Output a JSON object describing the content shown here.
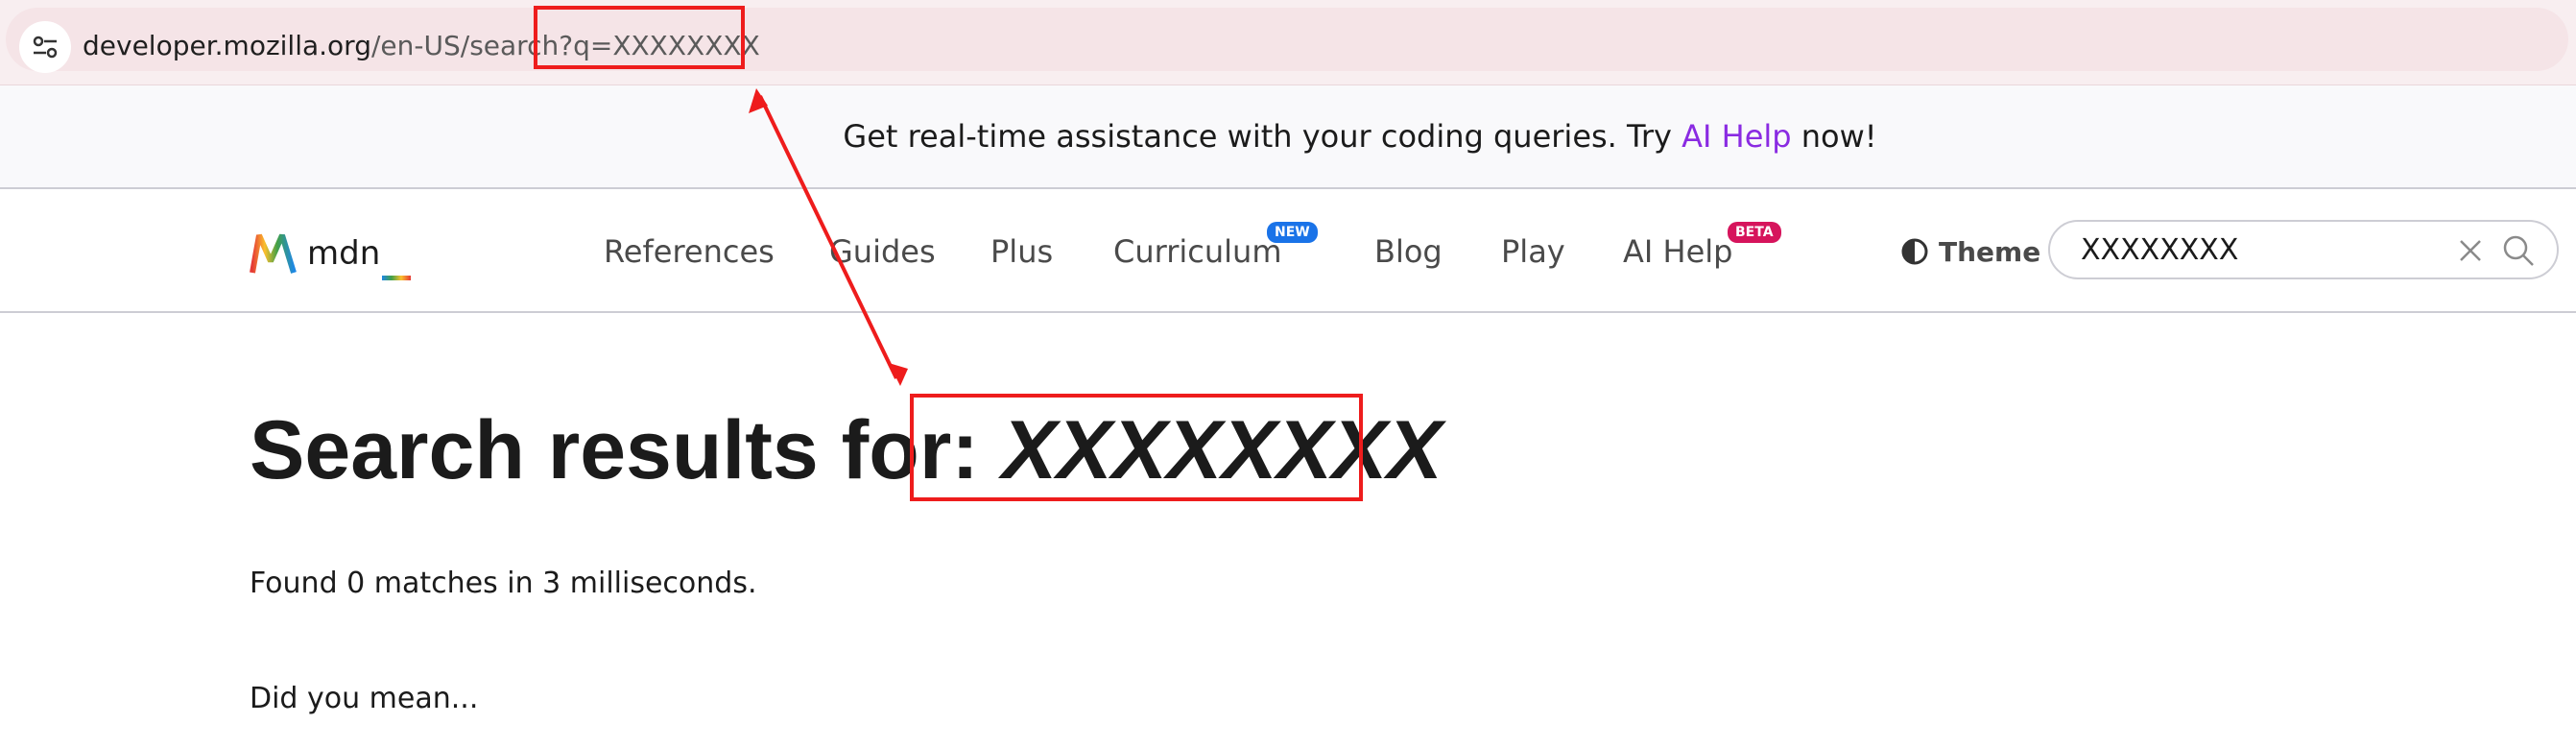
{
  "browser": {
    "url_host": "developer.mozilla.org",
    "url_path": "/en-US/search",
    "url_query": "?q=XXXXXXXX"
  },
  "banner": {
    "text": "Get real-time assistance with your coding queries. Try",
    "link": "AI Help",
    "tail": "now!"
  },
  "header": {
    "logo_text": "mdn",
    "nav": [
      "References",
      "Guides",
      "Plus",
      "Curriculum",
      "Blog",
      "Play",
      "AI Help"
    ],
    "badge_new": "NEW",
    "badge_beta": "BETA",
    "theme_label": "Theme",
    "search_value": "XXXXXXXX"
  },
  "main": {
    "heading_prefix": "Search results for:",
    "heading_query": "XXXXXXXX",
    "found_text": "Found 0 matches in 3 milliseconds.",
    "did_you_mean": "Did you mean..."
  },
  "colors": {
    "annotation_red": "#ee1c1c",
    "ai_help_link": "#8a2be2",
    "badge_new": "#1a73e8",
    "badge_beta": "#d6145c"
  }
}
